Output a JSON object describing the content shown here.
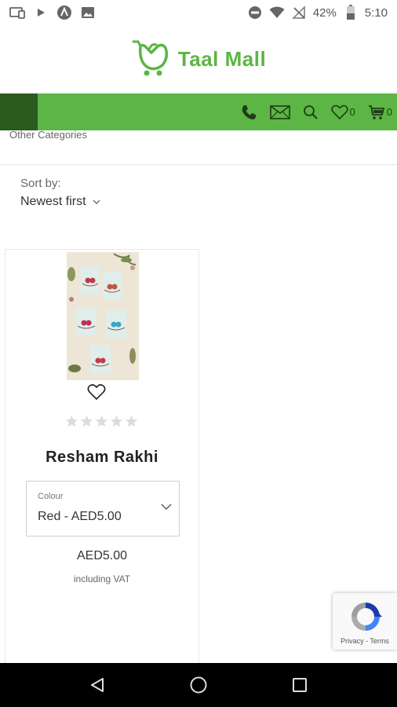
{
  "status_bar": {
    "battery_percent": "42%",
    "time": "5:10"
  },
  "header": {
    "logo_text": "Taal Mall"
  },
  "nav": {
    "wishlist_count": "0",
    "cart_count": "0"
  },
  "categories_link": "Other Categories",
  "sort": {
    "label": "Sort by:",
    "value": "Newest first"
  },
  "product": {
    "name": "Resham Rakhi",
    "rating": 0,
    "rating_max": 5,
    "variant_label": "Colour",
    "variant_value": "Red - AED5.00",
    "price": "AED5.00",
    "vat_note": "including VAT"
  },
  "recaptcha": {
    "links": "Privacy - Terms"
  },
  "colors": {
    "brand_green": "#5cb544",
    "menu_dark_green": "#2b5a1e"
  }
}
